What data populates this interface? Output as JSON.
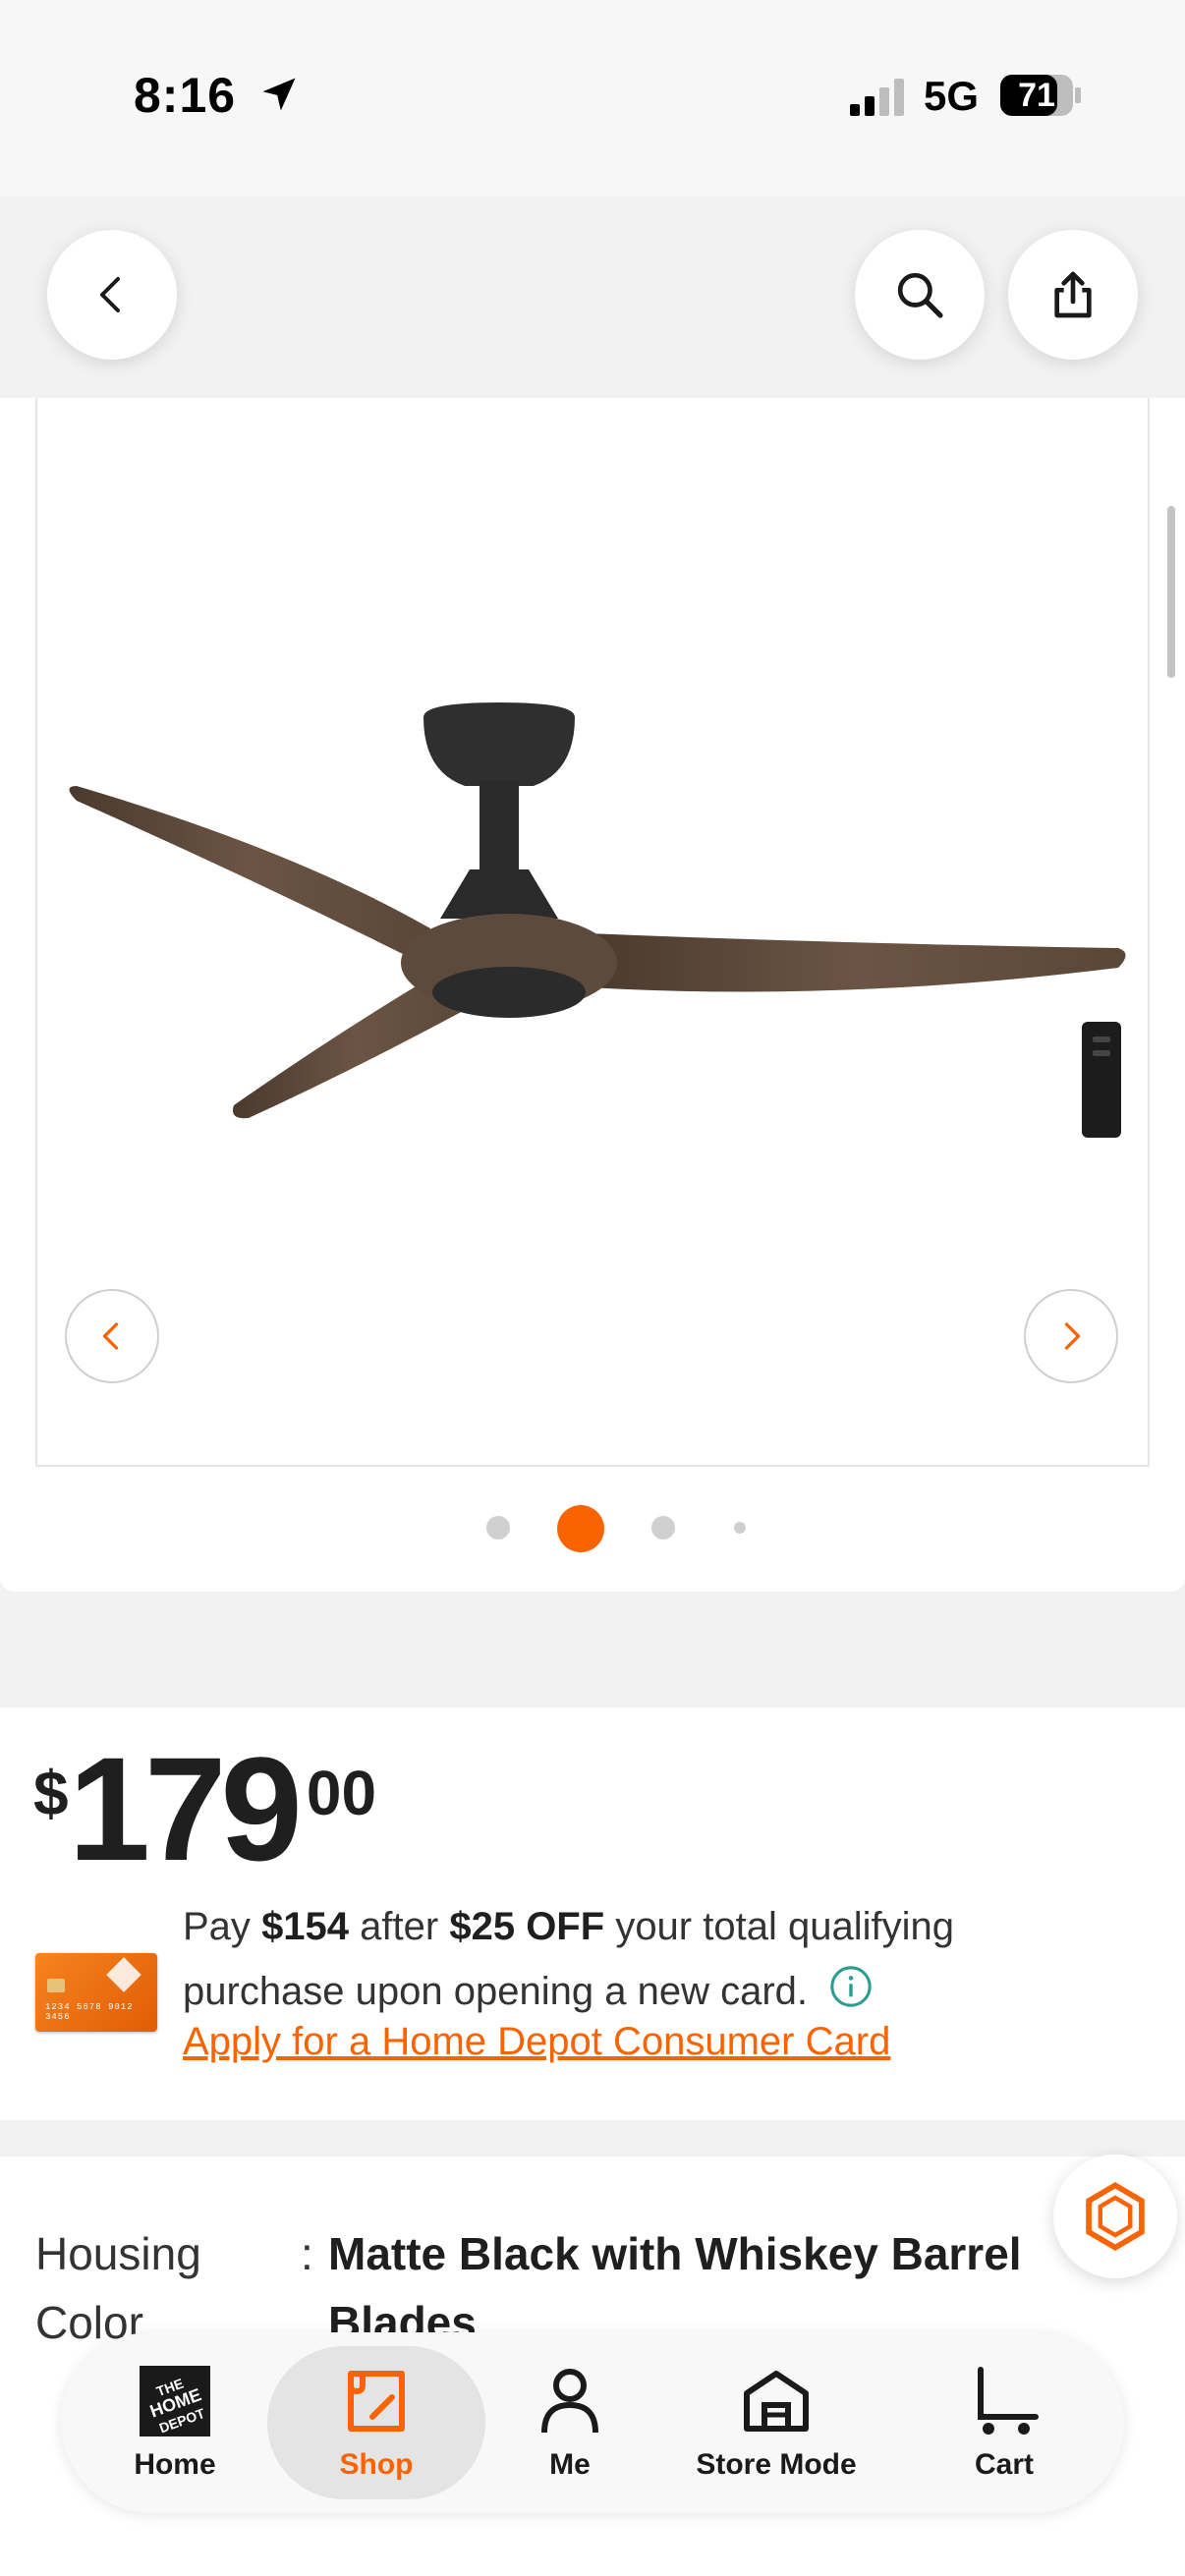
{
  "status_bar": {
    "time": "8:16",
    "network": "5G",
    "battery": "71"
  },
  "nav": {
    "back_icon": "chevron-left-icon",
    "search_icon": "search-icon",
    "share_icon": "share-icon"
  },
  "gallery": {
    "image_alt": "ceiling-fan-image",
    "active_index": 1,
    "dot_count": 4
  },
  "price": {
    "currency": "$",
    "dollars": "179",
    "cents": "00"
  },
  "promo": {
    "pay_prefix": "Pay",
    "pay_amount": "$154",
    "after": "after",
    "discount": "$25 OFF",
    "rest": "your total qualifying purchase upon opening a new card.",
    "apply_link": "Apply for a Home Depot Consumer Card",
    "card_number": "1234 5678 9012 3456"
  },
  "spec": {
    "label": "Housing Color",
    "colon": ":",
    "value": "Matte Black with Whiskey Barrel Blades"
  },
  "tabs": [
    {
      "label": "Home",
      "icon": "home-depot-logo-icon"
    },
    {
      "label": "Shop",
      "icon": "shop-icon"
    },
    {
      "label": "Me",
      "icon": "person-icon"
    },
    {
      "label": "Store Mode",
      "icon": "store-icon"
    },
    {
      "label": "Cart",
      "icon": "cart-icon"
    }
  ],
  "colors": {
    "brand_orange": "#f96302",
    "text": "#1f1f1f",
    "accent_teal": "#2a9d8f"
  }
}
